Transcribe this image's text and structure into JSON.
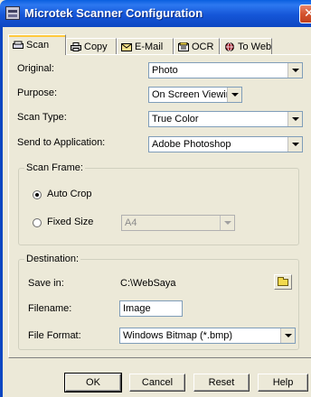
{
  "window": {
    "title": "Microtek Scanner Configuration",
    "close_glyph": "✕"
  },
  "tabs": [
    {
      "label": "Scan",
      "icon": "scan-icon",
      "active": true
    },
    {
      "label": "Copy",
      "icon": "printer-icon",
      "active": false
    },
    {
      "label": "E-Mail",
      "icon": "email-icon",
      "active": false
    },
    {
      "label": "OCR",
      "icon": "ocr-icon",
      "active": false
    },
    {
      "label": "To Web",
      "icon": "globe-icon",
      "active": false
    }
  ],
  "fields": {
    "original": {
      "label": "Original:",
      "value": "Photo"
    },
    "purpose": {
      "label": "Purpose:",
      "value": "On Screen Viewing"
    },
    "scan_type": {
      "label": "Scan Type:",
      "value": "True Color"
    },
    "send_to": {
      "label": "Send to Application:",
      "value": "Adobe Photoshop"
    }
  },
  "scan_frame": {
    "title": "Scan Frame:",
    "auto_crop": {
      "label": "Auto Crop",
      "selected": true
    },
    "fixed_size": {
      "label": "Fixed Size",
      "selected": false,
      "value": "A4"
    }
  },
  "destination": {
    "title": "Destination:",
    "save_in": {
      "label": "Save in:",
      "value": "C:\\WebSaya"
    },
    "filename": {
      "label": "Filename:",
      "value": "Image"
    },
    "file_format": {
      "label": "File Format:",
      "value": "Windows Bitmap (*.bmp)"
    }
  },
  "buttons": {
    "ok": "OK",
    "cancel": "Cancel",
    "reset": "Reset",
    "help": "Help"
  },
  "colors": {
    "title_bar": "#1556d8",
    "dialog_bg": "#ece9d8",
    "close_button": "#d4532e",
    "active_tab_accent": "#ffc83c"
  }
}
